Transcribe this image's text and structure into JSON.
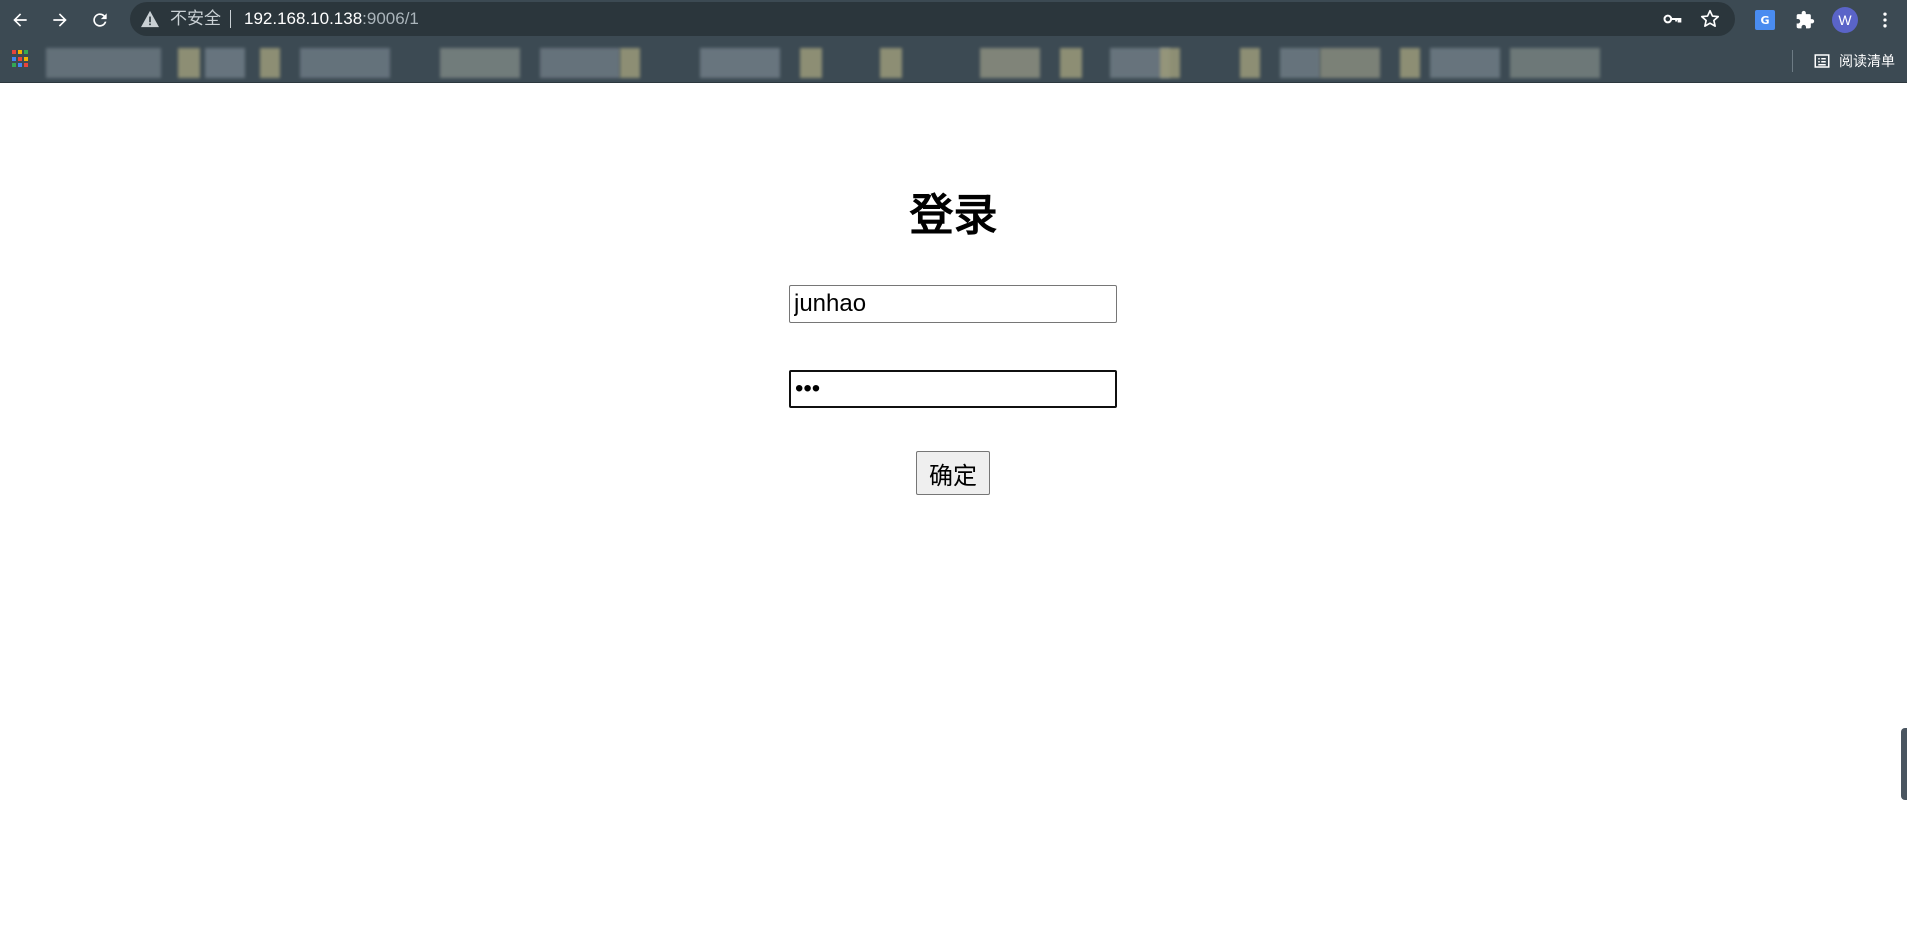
{
  "browser": {
    "security_label": "不安全",
    "url_host": "192.168.10.138",
    "url_path": ":9006/1",
    "avatar_letter": "W",
    "translate_badge": "G",
    "reading_list_label": "阅读清单",
    "colors": {
      "chrome": "#3c4a53",
      "omnibox": "#2b363c",
      "avatar": "#5a64c8"
    }
  },
  "login": {
    "title": "登录",
    "username_value": "junhao",
    "password_value": "abc",
    "submit_label": "确定"
  },
  "icons": {
    "back": "arrow-left-icon",
    "forward": "arrow-right-icon",
    "reload": "reload-icon",
    "warning": "warning-icon",
    "key": "key-icon",
    "star": "star-icon",
    "translate": "translate-icon",
    "extensions": "puzzle-icon",
    "menu": "more-vert-icon",
    "apps": "apps-grid-icon",
    "reading_list": "reading-list-icon"
  }
}
